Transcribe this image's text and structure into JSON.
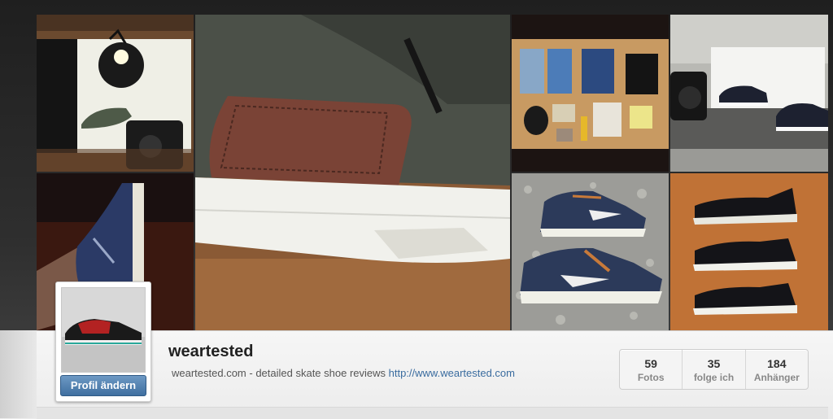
{
  "profile": {
    "username": "weartested",
    "bio_text": "weartested.com - detailed skate shoe reviews",
    "bio_link": "http://www.weartested.com",
    "edit_button_label": "Profil ändern"
  },
  "stats": [
    {
      "value": "59",
      "label": "Fotos"
    },
    {
      "value": "35",
      "label": "folge ich"
    },
    {
      "value": "184",
      "label": "Anhänger"
    }
  ],
  "colors": {
    "link": "#3a6c9f",
    "button": "#4a7aab",
    "page_dark": "#2b2b2b"
  },
  "grid_photos": [
    "photo-studio-lamp-shoe",
    "photo-suede-shoe-closeup",
    "photo-flatlay-clothing",
    "photo-shoes-on-table",
    "photo-blue-hightop",
    "photo-nike-shoes-gravel",
    "photo-three-adidas-shoes"
  ]
}
